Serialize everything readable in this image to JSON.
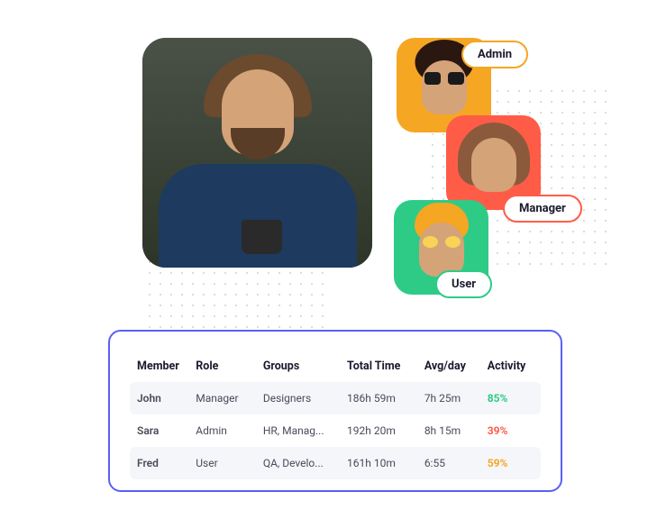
{
  "roleBadges": {
    "admin": "Admin",
    "manager": "Manager",
    "user": "User"
  },
  "table": {
    "headers": {
      "member": "Member",
      "role": "Role",
      "groups": "Groups",
      "totalTime": "Total Time",
      "avgDay": "Avg/day",
      "activity": "Activity"
    },
    "rows": [
      {
        "member": "John",
        "role": "Manager",
        "groups": "Designers",
        "totalTime": "186h 59m",
        "avgDay": "7h 25m",
        "activity": "85%",
        "activityLevel": "high"
      },
      {
        "member": "Sara",
        "role": "Admin",
        "groups": "HR, Manag...",
        "totalTime": "192h 20m",
        "avgDay": "8h 15m",
        "activity": "39%",
        "activityLevel": "low"
      },
      {
        "member": "Fred",
        "role": "User",
        "groups": "QA, Develo...",
        "totalTime": "161h 10m",
        "avgDay": "6:55",
        "activity": "59%",
        "activityLevel": "mid"
      }
    ]
  }
}
